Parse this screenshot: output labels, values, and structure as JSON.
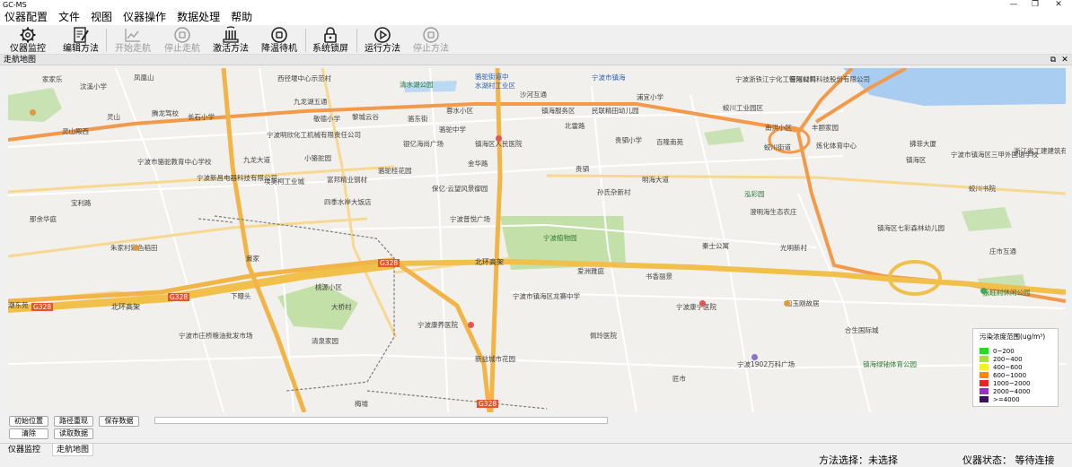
{
  "window": {
    "title": "GC-MS",
    "minimize": "—",
    "maximize": "❐",
    "close": "✕"
  },
  "menu": [
    "仪器配置",
    "文件",
    "视图",
    "仪器操作",
    "数据处理",
    "帮助"
  ],
  "toolbar": {
    "monitor": "仪器监控",
    "edit_method": "编辑方法",
    "start_nav": "开始走航",
    "stop_nav": "停止走航",
    "activate_method": "激活方法",
    "cooldown_standby": "降温待机",
    "system_lock": "系统锁屏",
    "run_method": "运行方法",
    "stop_method": "停止方法"
  },
  "panel": {
    "title": "走航地图",
    "float": "⧉",
    "close": "✕"
  },
  "map_labels": {
    "l1": "家家乐",
    "l2": "汶溪小学",
    "l3": "凤凰山",
    "l4": "西径堰中心示范村",
    "l5": "骆驼街道中",
    "l6": "清水湖公园",
    "l7": "骆驼街道",
    "l8": "水湖村工业区",
    "l9": "沙河互通",
    "l10": "宁波市镇海",
    "l11": "浦宜小学",
    "l12": "宁波浙铁江宁化工有限公司",
    "l13": "恒河材料科技股份有限公司",
    "l14": "九龙湖五通",
    "l15": "敬德小学",
    "l16": "黎城云谷",
    "l17": "骆东街",
    "l18": "蓉水小区",
    "l19": "镇海服务区",
    "l20": "民联精田幼儿园",
    "l21": "蛟川工业园区",
    "l22": "南洪小区",
    "l23": "丰颐家园",
    "l24": "腾龙驾校",
    "l25": "长石小学",
    "l26": "灵山殿西",
    "l27": "灵山",
    "l28": "宁波明欣化工机械有限责任公司",
    "l29": "骆驼中学",
    "l30": "镇海区人民医院",
    "l31": "银亿海尚广场",
    "l32": "北雷路",
    "l33": "贵驷小学",
    "l34": "百隆南苑",
    "l35": "蛟川街道",
    "l36": "炼化体育中心",
    "l37": "镇海区",
    "l38": "拂菲大厦",
    "l39": "九龙大道",
    "l40": "小骆驼园",
    "l41": "宁波市骆驼教育中心学校",
    "l42": "骆驼桂花园",
    "l43": "金华路",
    "l44": "贵驷",
    "l45": "宁波市镇海区三甲外国语学校",
    "l46": "浙江省工建建筑有限公司",
    "l47": "宁波新昌电器科技有限公司",
    "l48": "埃美柯工业城",
    "l49": "富邦精业钢材",
    "l50": "保亿·云望风景御园",
    "l51": "孙氏杂新村",
    "l52": "明海大道",
    "l53": "蛟川书院",
    "l54": "澄明海生态农庄",
    "l55": "宝利路",
    "l56": "秦栅西路",
    "l57": "四季水岸大饭店",
    "l58": "宁波普悦广场",
    "l59": "泓彩园",
    "l60": "镇海区七彩森林幼儿园",
    "l61": "那余华庭",
    "l62": "朱家村彩色稻田",
    "l63": "宁波植物园",
    "l64": "秦士公寓",
    "l65": "光明新村",
    "l66": "庄市互通",
    "l67": "永旺村休闲公园",
    "l68": "北环高架",
    "l69": "爱洲雅庭",
    "l70": "书香丽景",
    "l71": "桃源小区",
    "l72": "宁波市镇海区龙赛中学",
    "l73": "宁波康宁医院",
    "l74": "包玉刚故居",
    "l75": "宁波市庄桥粮油批发市场",
    "l76": "宁波康养医院",
    "l77": "合生国际城",
    "l78": "潮东苑",
    "l79": "北环高架",
    "l80": "佩玲医院",
    "l81": "清泉家园",
    "l82": "新益城市花园",
    "l83": "宁波1902万科广场",
    "l84": "镇海绿轴体育公园",
    "l85": "G328",
    "l86": "G328",
    "l87": "G328",
    "l88": "G328",
    "l89": "下曝头",
    "l90": "冀家",
    "l91": "梅墟",
    "l92": "匠市",
    "l93": "大桥村"
  },
  "legend": {
    "title": "污染浓度范围(ug/m³)",
    "items": [
      {
        "label": "0~200",
        "color": "#22dd22"
      },
      {
        "label": "200~400",
        "color": "#a6e22e"
      },
      {
        "label": "400~600",
        "color": "#ffee22"
      },
      {
        "label": "600~1000",
        "color": "#ff8800"
      },
      {
        "label": "1000~2000",
        "color": "#ee2222"
      },
      {
        "label": "2000~4000",
        "color": "#9b30c8"
      },
      {
        "label": ">=4000",
        "color": "#3b1060"
      }
    ]
  },
  "controls": {
    "init_position": "初始位置",
    "replay_path": "路径重现",
    "save_data": "保存数据",
    "clear": "清除",
    "read_data": "读取数据"
  },
  "tabs": [
    "仪器监控",
    "走航地图"
  ],
  "status": {
    "method": "方法选择：未选择",
    "instrument": "仪器状态：  等待连接"
  }
}
